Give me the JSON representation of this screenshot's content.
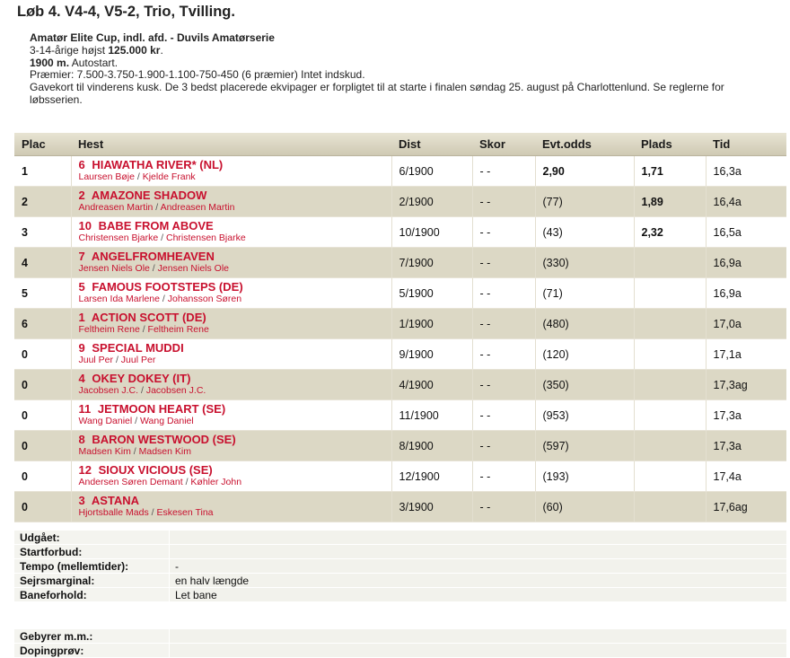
{
  "race": {
    "title": "Løb 4. V4-4, V5-2, Trio, Tvilling.",
    "name": "Amatør Elite Cup, indl. afd. - Duvils Amatørserie",
    "age_prefix": "3-14-årige højst ",
    "max_earnings": "125.000 kr",
    "age_suffix": ".",
    "distance": "1900 m.",
    "start_type": " Autostart.",
    "prizes": "Præmier: 7.500-3.750-1.900-1.100-750-450 (6 præmier) Intet indskud.",
    "note": "Gavekort til vinderens kusk. De 3 bedst placerede ekvipager er forpligtet til at starte i finalen søndag 25. august på Charlottenlund. Se reglerne for løbsserien."
  },
  "table": {
    "headers": {
      "plac": "Plac",
      "hest": "Hest",
      "dist": "Dist",
      "skor": "Skor",
      "odds": "Evt.odds",
      "plads": "Plads",
      "tid": "Tid"
    },
    "rows": [
      {
        "plac": "1",
        "num": "6",
        "horse": "HIAWATHA RIVER* (NL)",
        "driver": "Laursen Bøje",
        "trainer": "Kjelde Frank",
        "dist": "6/1900",
        "skor": "- -",
        "odds": "2,90",
        "plads": "1,71",
        "tid": "16,3a"
      },
      {
        "plac": "2",
        "num": "2",
        "horse": "AMAZONE SHADOW",
        "driver": "Andreasen Martin",
        "trainer": "Andreasen Martin",
        "dist": "2/1900",
        "skor": "- -",
        "odds": "(77)",
        "plads": "1,89",
        "tid": "16,4a"
      },
      {
        "plac": "3",
        "num": "10",
        "horse": "BABE FROM ABOVE",
        "driver": "Christensen Bjarke",
        "trainer": "Christensen Bjarke",
        "dist": "10/1900",
        "skor": "- -",
        "odds": "(43)",
        "plads": "2,32",
        "tid": "16,5a"
      },
      {
        "plac": "4",
        "num": "7",
        "horse": "ANGELFROMHEAVEN",
        "driver": "Jensen Niels Ole",
        "trainer": "Jensen Niels Ole",
        "dist": "7/1900",
        "skor": "- -",
        "odds": "(330)",
        "plads": "",
        "tid": "16,9a"
      },
      {
        "plac": "5",
        "num": "5",
        "horse": "FAMOUS FOOTSTEPS (DE)",
        "driver": "Larsen Ida Marlene",
        "trainer": "Johansson Søren",
        "dist": "5/1900",
        "skor": "- -",
        "odds": "(71)",
        "plads": "",
        "tid": "16,9a"
      },
      {
        "plac": "6",
        "num": "1",
        "horse": "ACTION SCOTT (DE)",
        "driver": "Feltheim Rene",
        "trainer": "Feltheim Rene",
        "dist": "1/1900",
        "skor": "- -",
        "odds": "(480)",
        "plads": "",
        "tid": "17,0a"
      },
      {
        "plac": "0",
        "num": "9",
        "horse": "SPECIAL MUDDI",
        "driver": "Juul Per",
        "trainer": "Juul Per",
        "dist": "9/1900",
        "skor": "- -",
        "odds": "(120)",
        "plads": "",
        "tid": "17,1a"
      },
      {
        "plac": "0",
        "num": "4",
        "horse": "OKEY DOKEY (IT)",
        "driver": "Jacobsen J.C.",
        "trainer": "Jacobsen J.C.",
        "dist": "4/1900",
        "skor": "- -",
        "odds": "(350)",
        "plads": "",
        "tid": "17,3ag"
      },
      {
        "plac": "0",
        "num": "11",
        "horse": "JETMOON HEART (SE)",
        "driver": "Wang Daniel",
        "trainer": "Wang Daniel",
        "dist": "11/1900",
        "skor": "- -",
        "odds": "(953)",
        "plads": "",
        "tid": "17,3a"
      },
      {
        "plac": "0",
        "num": "8",
        "horse": "BARON WESTWOOD (SE)",
        "driver": "Madsen Kim",
        "trainer": "Madsen Kim",
        "dist": "8/1900",
        "skor": "- -",
        "odds": "(597)",
        "plads": "",
        "tid": "17,3a"
      },
      {
        "plac": "0",
        "num": "12",
        "horse": "SIOUX VICIOUS (SE)",
        "driver": "Andersen Søren Demant",
        "trainer": "Køhler John",
        "dist": "12/1900",
        "skor": "- -",
        "odds": "(193)",
        "plads": "",
        "tid": "17,4a"
      },
      {
        "plac": "0",
        "num": "3",
        "horse": "ASTANA",
        "driver": "Hjortsballe Mads",
        "trainer": "Eskesen Tina",
        "dist": "3/1900",
        "skor": "- -",
        "odds": "(60)",
        "plads": "",
        "tid": "17,6ag"
      }
    ]
  },
  "details": [
    {
      "label": "Udgået:",
      "value": ""
    },
    {
      "label": "Startforbud:",
      "value": ""
    },
    {
      "label": "Tempo (mellemtider):",
      "value": "-"
    },
    {
      "label": "Sejrsmarginal:",
      "value": "en halv længde"
    },
    {
      "label": "Baneforhold:",
      "value": "Let bane"
    }
  ],
  "details2": [
    {
      "label": "Gebyrer m.m.:",
      "value": ""
    },
    {
      "label": "Dopingprøv:",
      "value": ""
    }
  ],
  "colors": {
    "horse_red": "#c8102e",
    "header_bg": "#d6d1bc",
    "row_shade": "#dcd8c5"
  }
}
